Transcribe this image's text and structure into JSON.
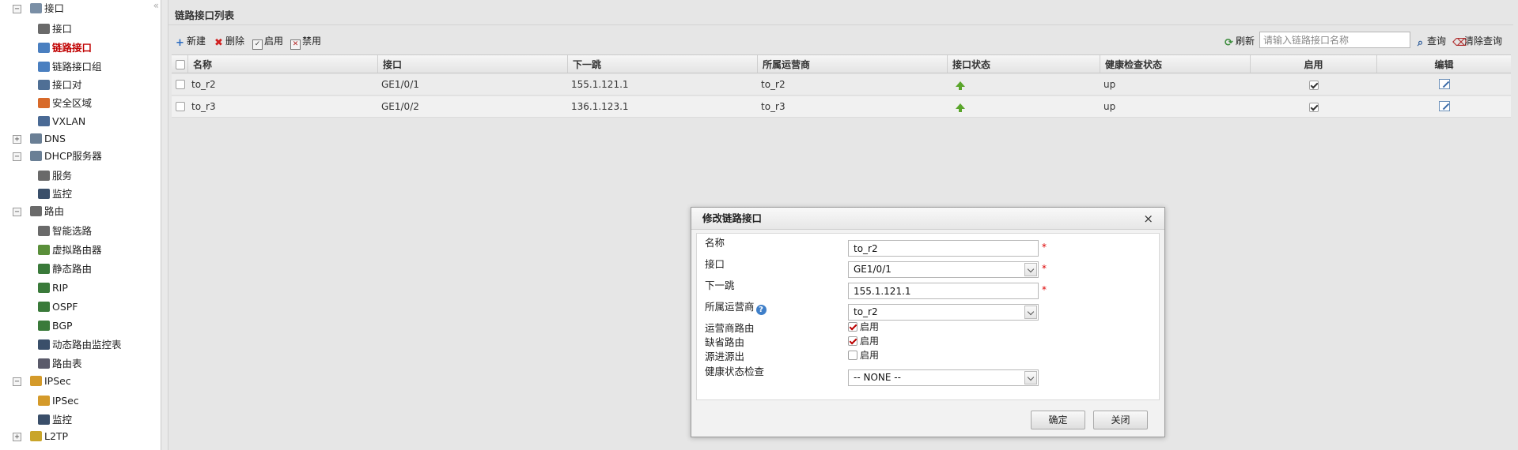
{
  "sidebar": {
    "collapse_glyph": "«",
    "items": [
      {
        "label": "接口",
        "icon": "interface-folder-icon",
        "color": "#7a8fa6",
        "expander": "−"
      },
      {
        "label": "接口",
        "icon": "interface-icon",
        "color": "#6a6a6a"
      },
      {
        "label": "链路接口",
        "icon": "link-interface-icon",
        "color": "#4a7fc0"
      },
      {
        "label": "链路接口组",
        "icon": "link-interface-group-icon",
        "color": "#4a7fc0"
      },
      {
        "label": "接口对",
        "icon": "interface-pair-icon",
        "color": "#4f6f95"
      },
      {
        "label": "安全区域",
        "icon": "security-zone-icon",
        "color": "#d86a2a"
      },
      {
        "label": "VXLAN",
        "icon": "vxlan-icon",
        "color": "#4a6a95"
      },
      {
        "label": "DNS",
        "icon": "dns-icon",
        "color": "#6a7f95",
        "expander": "+"
      },
      {
        "label": "DHCP服务器",
        "icon": "dhcp-server-icon",
        "color": "#6a7f95",
        "expander": "−"
      },
      {
        "label": "服务",
        "icon": "service-icon",
        "color": "#6a6a6a"
      },
      {
        "label": "监控",
        "icon": "monitor-icon",
        "color": "#3a4f6a"
      },
      {
        "label": "路由",
        "icon": "routing-icon",
        "color": "#6a6a6a",
        "expander": "−"
      },
      {
        "label": "智能选路",
        "icon": "smart-routing-icon",
        "color": "#6a6a6a"
      },
      {
        "label": "虚拟路由器",
        "icon": "virtual-router-icon",
        "color": "#5a8f3a"
      },
      {
        "label": "静态路由",
        "icon": "static-route-icon",
        "color": "#3a7a3a"
      },
      {
        "label": "RIP",
        "icon": "rip-icon",
        "color": "#3a7a3a"
      },
      {
        "label": "OSPF",
        "icon": "ospf-icon",
        "color": "#3a7a3a"
      },
      {
        "label": "BGP",
        "icon": "bgp-icon",
        "color": "#3a7a3a"
      },
      {
        "label": "动态路由监控表",
        "icon": "dynamic-route-monitor-icon",
        "color": "#3a4f6a"
      },
      {
        "label": "路由表",
        "icon": "route-table-icon",
        "color": "#5a5a6a"
      },
      {
        "label": "IPSec",
        "icon": "ipsec-icon",
        "color": "#d49a2a",
        "expander": "−"
      },
      {
        "label": "IPSec",
        "icon": "ipsec-policy-icon",
        "color": "#d49a2a"
      },
      {
        "label": "监控",
        "icon": "monitor-icon",
        "color": "#3a4f6a"
      },
      {
        "label": "L2TP",
        "icon": "l2tp-icon",
        "color": "#c9a52a",
        "expander": "+"
      }
    ]
  },
  "panel": {
    "title": "链路接口列表"
  },
  "toolbar": {
    "new_label": "新建",
    "delete_label": "删除",
    "enable_label": "启用",
    "disable_label": "禁用",
    "refresh_label": "刷新",
    "search_placeholder": "请输入链路接口名称",
    "query_label": "查询",
    "clear_label": "清除查询"
  },
  "table": {
    "columns": [
      "名称",
      "接口",
      "下一跳",
      "所属运营商",
      "接口状态",
      "健康检查状态",
      "启用",
      "编辑"
    ],
    "rows": [
      {
        "name": "to_r2",
        "interface": "GE1/0/1",
        "next_hop": "155.1.121.1",
        "isp": "to_r2",
        "status": "up-arrow",
        "health": "up",
        "enabled": true
      },
      {
        "name": "to_r3",
        "interface": "GE1/0/2",
        "next_hop": "136.1.123.1",
        "isp": "to_r3",
        "health": "up",
        "status": "up-arrow",
        "enabled": true
      }
    ]
  },
  "dialog": {
    "title": "修改链路接口",
    "close_glyph": "×",
    "name_label": "名称",
    "name_value": "to_r2",
    "interface_label": "接口",
    "interface_value": "GE1/0/1",
    "next_hop_label": "下一跳",
    "next_hop_value": "155.1.121.1",
    "isp_label": "所属运营商",
    "isp_value": "to_r2",
    "isp_route_label": "运营商路由",
    "isp_route_check": "启用",
    "isp_route_checked": true,
    "default_route_label": "缺省路由",
    "default_route_check": "启用",
    "default_route_checked": true,
    "source_in_out_label": "源进源出",
    "source_in_out_check": "启用",
    "source_in_out_checked": false,
    "health_check_label": "健康状态检查",
    "health_check_value": "-- NONE --",
    "required_mark": "*",
    "help_glyph": "?",
    "ok_label": "确定",
    "close_label": "关闭"
  },
  "colors": {
    "accent_link": "#1a5cb0",
    "active_nav": "#c00000",
    "status_up": "#5aa52b"
  }
}
